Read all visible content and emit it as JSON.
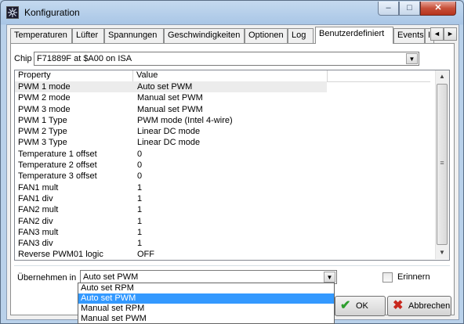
{
  "window": {
    "title": "Konfiguration",
    "minimize_glyph": "–",
    "maximize_glyph": "□",
    "close_glyph": "✕"
  },
  "tabs": [
    {
      "label": "Temperaturen",
      "active": false
    },
    {
      "label": "Lüfter",
      "active": false
    },
    {
      "label": "Spannungen",
      "active": false
    },
    {
      "label": "Geschwindigkeiten",
      "active": false
    },
    {
      "label": "Optionen",
      "active": false
    },
    {
      "label": "Log",
      "active": false
    },
    {
      "label": "Benutzerdefiniert",
      "active": true
    },
    {
      "label": "Events",
      "active": false
    },
    {
      "label": "I",
      "active": false
    }
  ],
  "tab_scroll": {
    "left": "◄",
    "right": "►"
  },
  "chip": {
    "label": "Chip",
    "value": "F71889F at $A00 on ISA"
  },
  "grid": {
    "columns": {
      "property": "Property",
      "value": "Value"
    },
    "rows": [
      {
        "property": "PWM 1 mode",
        "value": "Auto set PWM"
      },
      {
        "property": "PWM 2 mode",
        "value": "Manual set PWM"
      },
      {
        "property": "PWM 3 mode",
        "value": "Manual set PWM"
      },
      {
        "property": "PWM 1 Type",
        "value": "PWM mode (Intel 4-wire)"
      },
      {
        "property": "PWM 2 Type",
        "value": "Linear DC mode"
      },
      {
        "property": "PWM 3 Type",
        "value": "Linear DC mode"
      },
      {
        "property": "Temperature 1 offset",
        "value": "0"
      },
      {
        "property": "Temperature 2 offset",
        "value": "0"
      },
      {
        "property": "Temperature 3 offset",
        "value": "0"
      },
      {
        "property": "FAN1 mult",
        "value": "1"
      },
      {
        "property": "FAN1 div",
        "value": "1"
      },
      {
        "property": "FAN2 mult",
        "value": "1"
      },
      {
        "property": "FAN2 div",
        "value": "1"
      },
      {
        "property": "FAN3 mult",
        "value": "1"
      },
      {
        "property": "FAN3 div",
        "value": "1"
      },
      {
        "property": "Reverse PWM01 logic",
        "value": "OFF"
      }
    ],
    "selected_row": 0,
    "scrollbar": {
      "up": "▲",
      "down": "▼",
      "grip": "≡"
    }
  },
  "apply": {
    "label": "Übernehmen in",
    "value": "Auto set PWM",
    "options": [
      "Auto set RPM",
      "Auto set PWM",
      "Manual set RPM",
      "Manual set PWM"
    ],
    "highlighted_option": 1
  },
  "remember": {
    "label": "Erinnern",
    "checked": false
  },
  "buttons": {
    "ok": {
      "label": "OK",
      "icon_glyph": "✔"
    },
    "cancel": {
      "label": "Abbrechen",
      "icon_glyph": "✖"
    }
  },
  "colors": {
    "ok_icon": "#2e9e2e",
    "cancel_icon": "#c8281e",
    "highlight": "#3399ff"
  }
}
